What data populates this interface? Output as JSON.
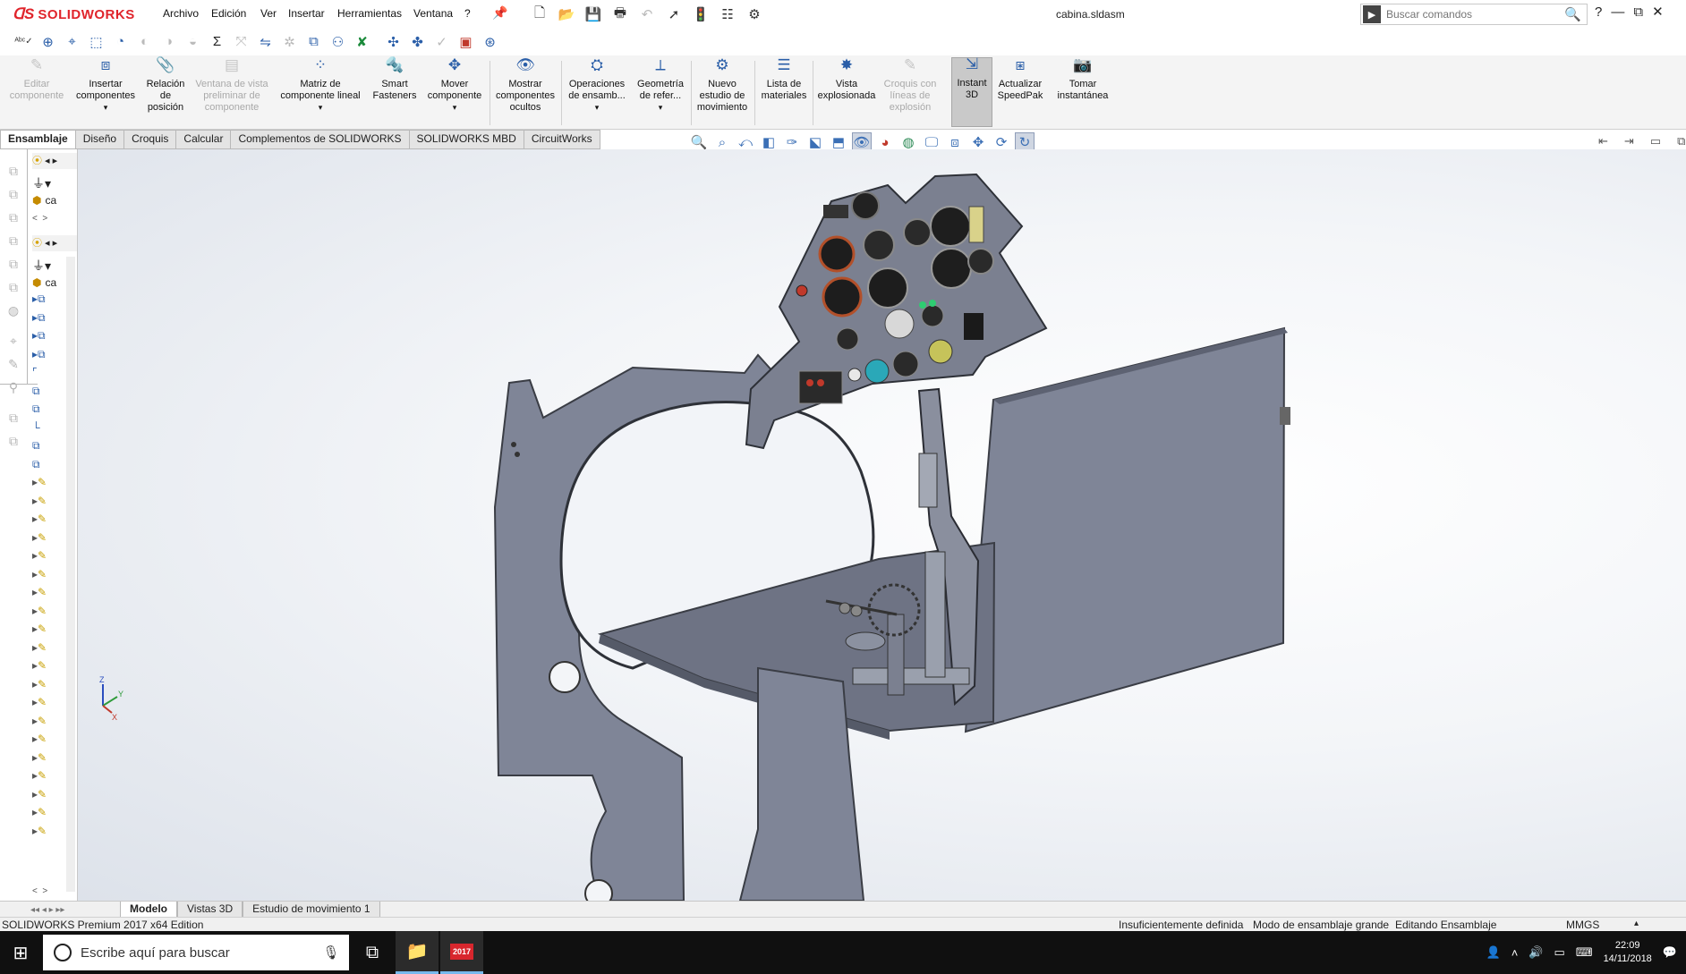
{
  "app": {
    "name": "SOLIDWORKS",
    "brand_color": "#e0242b"
  },
  "menu": [
    "Archivo",
    "Edición",
    "Ver",
    "Insertar",
    "Herramientas",
    "Ventana",
    "?"
  ],
  "document_title": "cabina.sldasm",
  "search": {
    "placeholder": "Buscar comandos"
  },
  "commands": [
    {
      "label": "Editar componente",
      "enabled": false,
      "icon": "edit-component-icon"
    },
    {
      "label": "Insertar componentes",
      "enabled": true,
      "icon": "insert-components-icon"
    },
    {
      "label": "Relación de posición",
      "enabled": true,
      "icon": "mate-icon"
    },
    {
      "label": "Ventana de vista preliminar de componente",
      "enabled": false,
      "icon": "preview-window-icon"
    },
    {
      "label": "Matriz de componente lineal",
      "enabled": true,
      "icon": "linear-pattern-icon"
    },
    {
      "label": "Smart Fasteners",
      "enabled": true,
      "icon": "smart-fasteners-icon"
    },
    {
      "label": "Mover componente",
      "enabled": true,
      "icon": "move-component-icon"
    },
    {
      "label": "Mostrar componentes ocultos",
      "enabled": true,
      "icon": "show-hidden-icon"
    },
    {
      "label": "Operaciones de ensamb...",
      "enabled": true,
      "icon": "assembly-features-icon"
    },
    {
      "label": "Geometría de refer...",
      "enabled": true,
      "icon": "reference-geometry-icon"
    },
    {
      "label": "Nuevo estudio de movimiento",
      "enabled": true,
      "icon": "motion-study-icon"
    },
    {
      "label": "Lista de materiales",
      "enabled": true,
      "icon": "bom-icon"
    },
    {
      "label": "Vista explosionada",
      "enabled": true,
      "icon": "exploded-view-icon"
    },
    {
      "label": "Croquis con líneas de explosión",
      "enabled": false,
      "icon": "explode-line-sketch-icon"
    },
    {
      "label": "Instant 3D",
      "enabled": true,
      "active": true,
      "icon": "instant3d-icon"
    },
    {
      "label": "Actualizar SpeedPak",
      "enabled": true,
      "icon": "speedpak-icon"
    },
    {
      "label": "Tomar instantánea",
      "enabled": true,
      "icon": "snapshot-icon"
    }
  ],
  "tabs": [
    "Ensamblaje",
    "Diseño",
    "Croquis",
    "Calcular",
    "Complementos de SOLIDWORKS",
    "SOLIDWORKS MBD",
    "CircuitWorks"
  ],
  "active_tab": "Ensamblaje",
  "tree": {
    "root_label_1": "ca",
    "root_label_2": "ca"
  },
  "triad": {
    "x": "X",
    "y": "Y",
    "z": "Z"
  },
  "bottom_tabs": [
    "Modelo",
    "Vistas 3D",
    "Estudio de movimiento 1"
  ],
  "status": {
    "edition": "SOLIDWORKS Premium 2017 x64 Edition",
    "definition": "Insuficientemente definida",
    "mode": "Modo de ensamblaje grande",
    "editing": "Editando Ensamblaje",
    "units": "MMGS"
  },
  "taskbar": {
    "search_placeholder": "Escribe aquí para buscar",
    "time": "22:09",
    "date": "14/11/2018",
    "sw_badge": "2017"
  }
}
